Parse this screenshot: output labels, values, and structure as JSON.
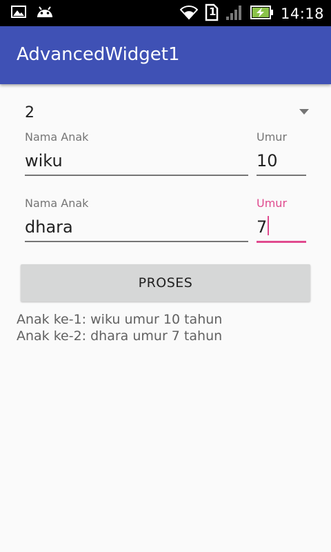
{
  "status_bar": {
    "time": "14:18",
    "icons": [
      "image-icon",
      "android-icon",
      "wifi-icon",
      "sim-icon",
      "signal-icon",
      "battery-charging-icon"
    ],
    "sim_label": "1"
  },
  "app_bar": {
    "title": "AdvancedWidget1",
    "color": "#3f51b5"
  },
  "spinner": {
    "selected": "2"
  },
  "children": [
    {
      "name_label": "Nama Anak",
      "name_value": "wiku",
      "age_label": "Umur",
      "age_value": "10"
    },
    {
      "name_label": "Nama Anak",
      "name_value": "dhara",
      "age_label": "Umur",
      "age_value": "7"
    }
  ],
  "accent_color": "#e04a8e",
  "button": {
    "label": "PROSES"
  },
  "result": {
    "line1": "Anak ke-1: wiku umur 10 tahun",
    "line2": "Anak ke-2: dhara umur 7 tahun"
  }
}
